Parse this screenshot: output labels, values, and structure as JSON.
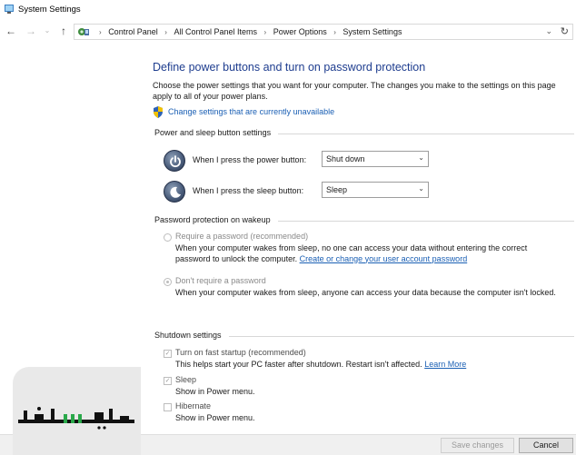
{
  "window": {
    "title": "System Settings"
  },
  "address": {
    "crumbs": [
      "Control Panel",
      "All Control Panel Items",
      "Power Options",
      "System Settings"
    ]
  },
  "main": {
    "heading": "Define power buttons and turn on password protection",
    "description": "Choose the power settings that you want for your computer. The changes you make to the settings on this page apply to all of your power plans.",
    "change_link": "Change settings that are currently unavailable"
  },
  "power_section": {
    "label": "Power and sleep button settings",
    "power_button_label": "When I press the power button:",
    "power_button_value": "Shut down",
    "sleep_button_label": "When I press the sleep button:",
    "sleep_button_value": "Sleep"
  },
  "password_section": {
    "label": "Password protection on wakeup",
    "require": {
      "title": "Require a password (recommended)",
      "desc": "When your computer wakes from sleep, no one can access your data without entering the correct password to unlock the computer.",
      "link": "Create or change your user account password",
      "checked": false
    },
    "dont_require": {
      "title": "Don't require a password",
      "desc": "When your computer wakes from sleep, anyone can access your data because the computer isn't locked.",
      "checked": true
    }
  },
  "shutdown_section": {
    "label": "Shutdown settings",
    "fast_startup": {
      "title": "Turn on fast startup (recommended)",
      "desc": "This helps start your PC faster after shutdown. Restart isn't affected.",
      "link": "Learn More",
      "checked": true
    },
    "sleep": {
      "title": "Sleep",
      "desc": "Show in Power menu.",
      "checked": true
    },
    "hibernate": {
      "title": "Hibernate",
      "desc": "Show in Power menu.",
      "checked": false
    }
  },
  "footer": {
    "save_label": "Save changes",
    "cancel_label": "Cancel"
  },
  "watermark": {
    "text": "فاسنجي"
  },
  "colors": {
    "heading": "#1e3d8f",
    "link": "#1a5fb4",
    "footer_bg": "#f0f0f0"
  }
}
